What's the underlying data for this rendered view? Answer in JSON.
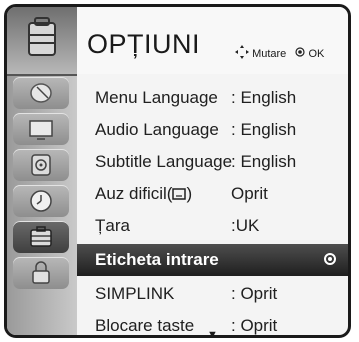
{
  "header": {
    "title": "OPȚIUNI",
    "move_label": "Mutare",
    "ok_label": "OK"
  },
  "sidebar": {
    "items": [
      {
        "name": "satellite-dish-icon"
      },
      {
        "name": "tv-screen-icon"
      },
      {
        "name": "speaker-icon"
      },
      {
        "name": "clock-icon"
      },
      {
        "name": "options-case-icon"
      },
      {
        "name": "lock-icon"
      }
    ]
  },
  "menu": {
    "rows": [
      {
        "label": "Menu Language",
        "value": ": English"
      },
      {
        "label": "Audio Language",
        "value": ": English"
      },
      {
        "label": "Subtitle Language",
        "value": ": English"
      },
      {
        "label": "Auz dificil(",
        "value": "Oprit"
      },
      {
        "label": "Țara",
        "value": ":UK"
      },
      {
        "label": "Eticheta intrare",
        "value": ""
      },
      {
        "label": "SIMPLINK",
        "value": ": Oprit"
      },
      {
        "label": "Blocare taste",
        "value": ": Oprit"
      }
    ],
    "selected_index": 5
  },
  "colors": {
    "selected_row": "#2a2a2a",
    "sidebar_bg": "#b0b0b0"
  }
}
